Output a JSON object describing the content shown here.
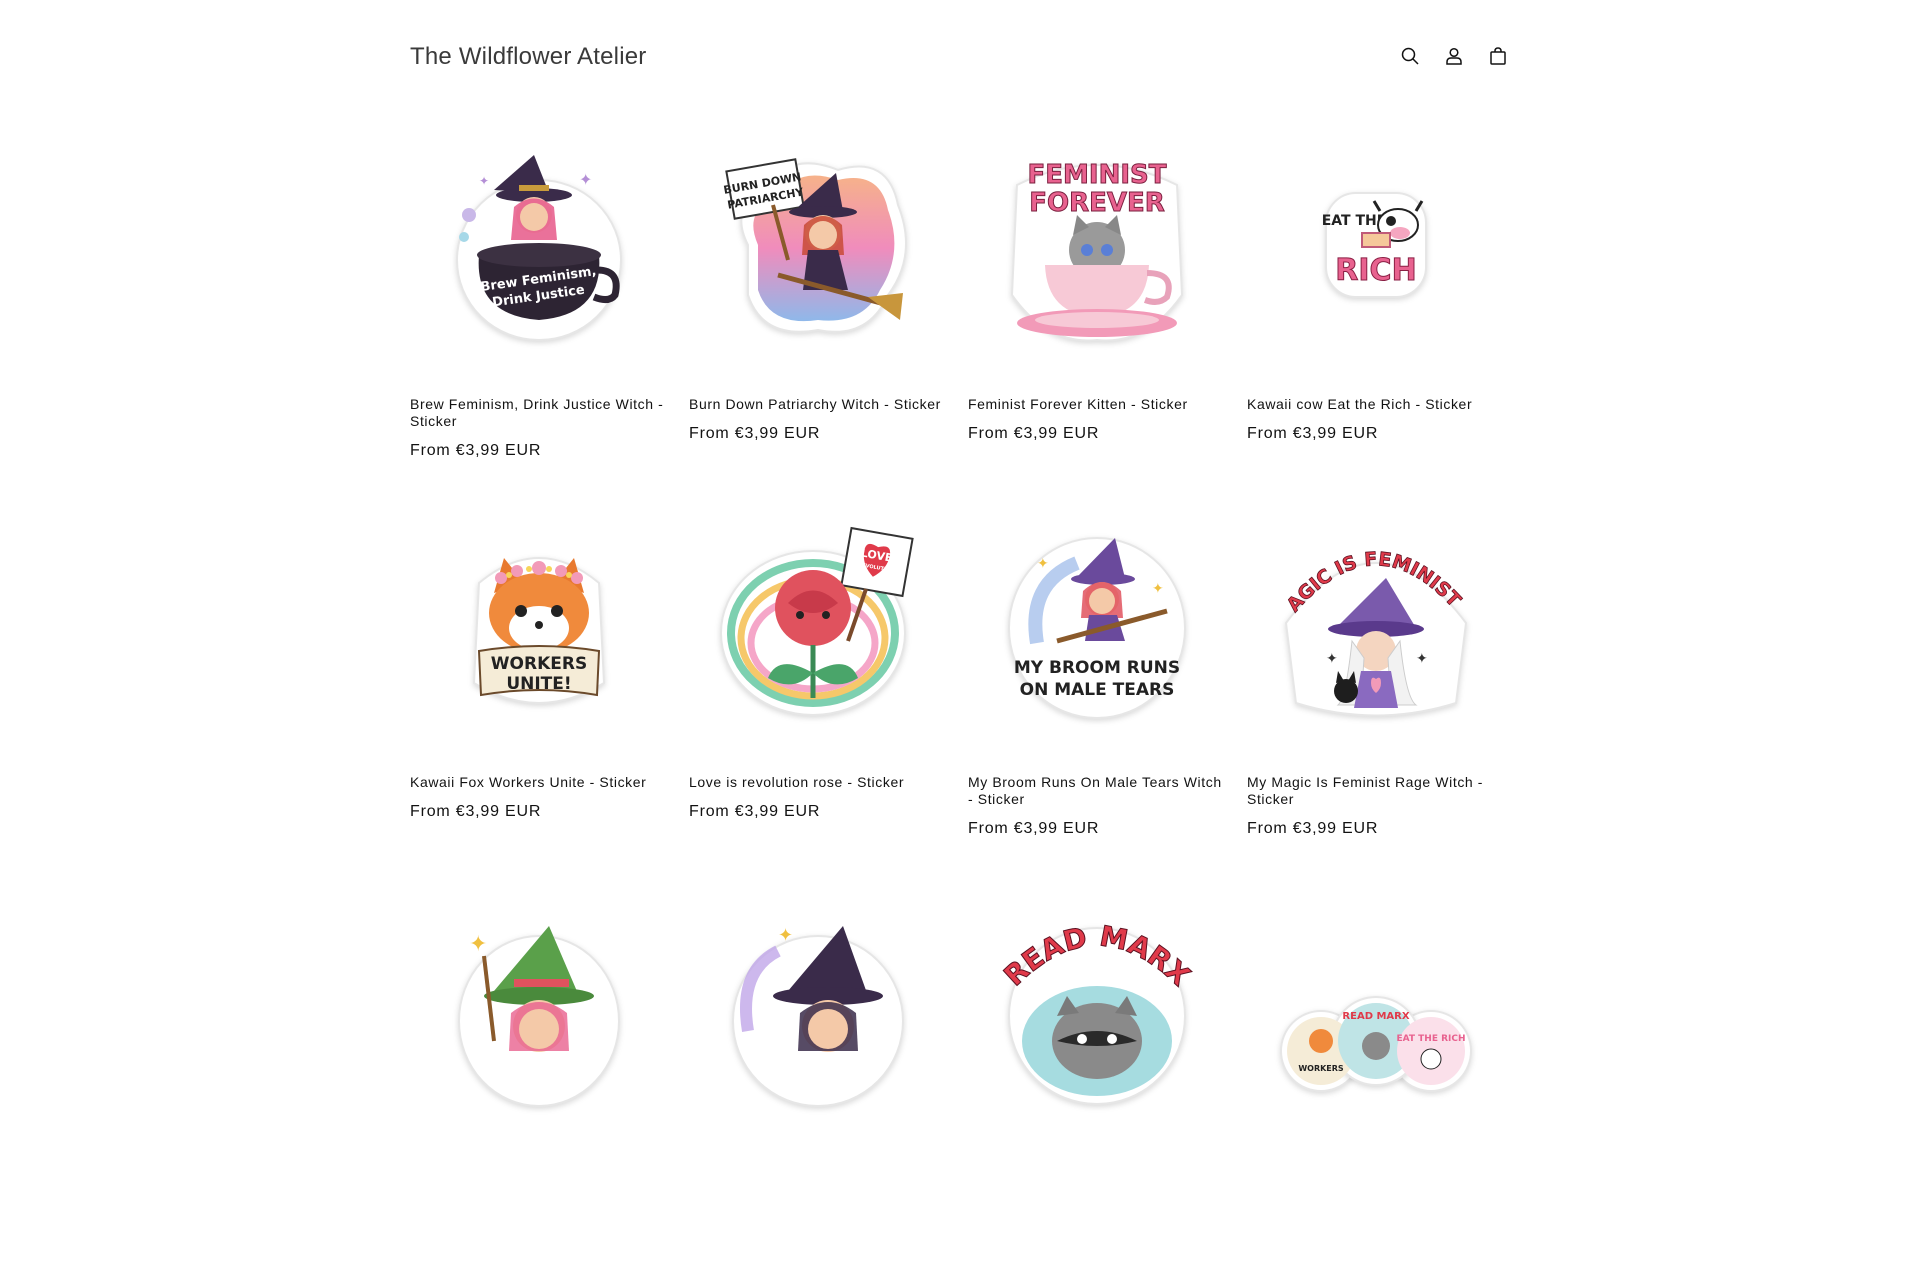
{
  "header": {
    "store_name": "The Wildflower Atelier",
    "icons": [
      "search-icon",
      "account-icon",
      "cart-icon"
    ]
  },
  "colors": {
    "text": "#121212",
    "background": "#ffffff",
    "pink": "#e8628f",
    "purple": "#6a4a9c"
  },
  "products": [
    {
      "title": "Brew Feminism, Drink Justice Witch - Sticker",
      "price": "From €3,99 EUR",
      "sticker_text": [
        "Brew Feminism,",
        "Drink Justice"
      ]
    },
    {
      "title": "Burn Down Patriarchy Witch - Sticker",
      "price": "From €3,99 EUR",
      "sticker_text": [
        "BURN DOWN",
        "PATRIARCHY"
      ]
    },
    {
      "title": "Feminist Forever Kitten - Sticker",
      "price": "From €3,99 EUR",
      "sticker_text": [
        "FEMINIST",
        "FOREVER"
      ]
    },
    {
      "title": "Kawaii cow Eat the Rich - Sticker",
      "price": "From €3,99 EUR",
      "sticker_text": [
        "EAT THE",
        "RICH"
      ]
    },
    {
      "title": "Kawaii Fox Workers Unite - Sticker",
      "price": "From €3,99 EUR",
      "sticker_text": [
        "WORKERS",
        "UNITE!"
      ]
    },
    {
      "title": "Love is revolution rose - Sticker",
      "price": "From €3,99 EUR",
      "sticker_text": [
        "LOVE",
        "REVOLUTION"
      ]
    },
    {
      "title": "My Broom Runs On Male Tears Witch - Sticker",
      "price": "From €3,99 EUR",
      "sticker_text": [
        "MY BROOM RUNS",
        "ON MALE TEARS"
      ]
    },
    {
      "title": "My Magic Is Feminist Rage Witch - Sticker",
      "price": "From €3,99 EUR",
      "sticker_text": [
        "MY MAGIC IS FEMINIST RAGE"
      ]
    },
    {
      "title": "",
      "price": "",
      "sticker_text": []
    },
    {
      "title": "",
      "price": "",
      "sticker_text": []
    },
    {
      "title": "",
      "price": "",
      "sticker_text": [
        "READ MARX"
      ]
    },
    {
      "title": "",
      "price": "",
      "sticker_text": [
        "WORKERS",
        "READ MARX",
        "EAT THE RICH"
      ]
    }
  ]
}
